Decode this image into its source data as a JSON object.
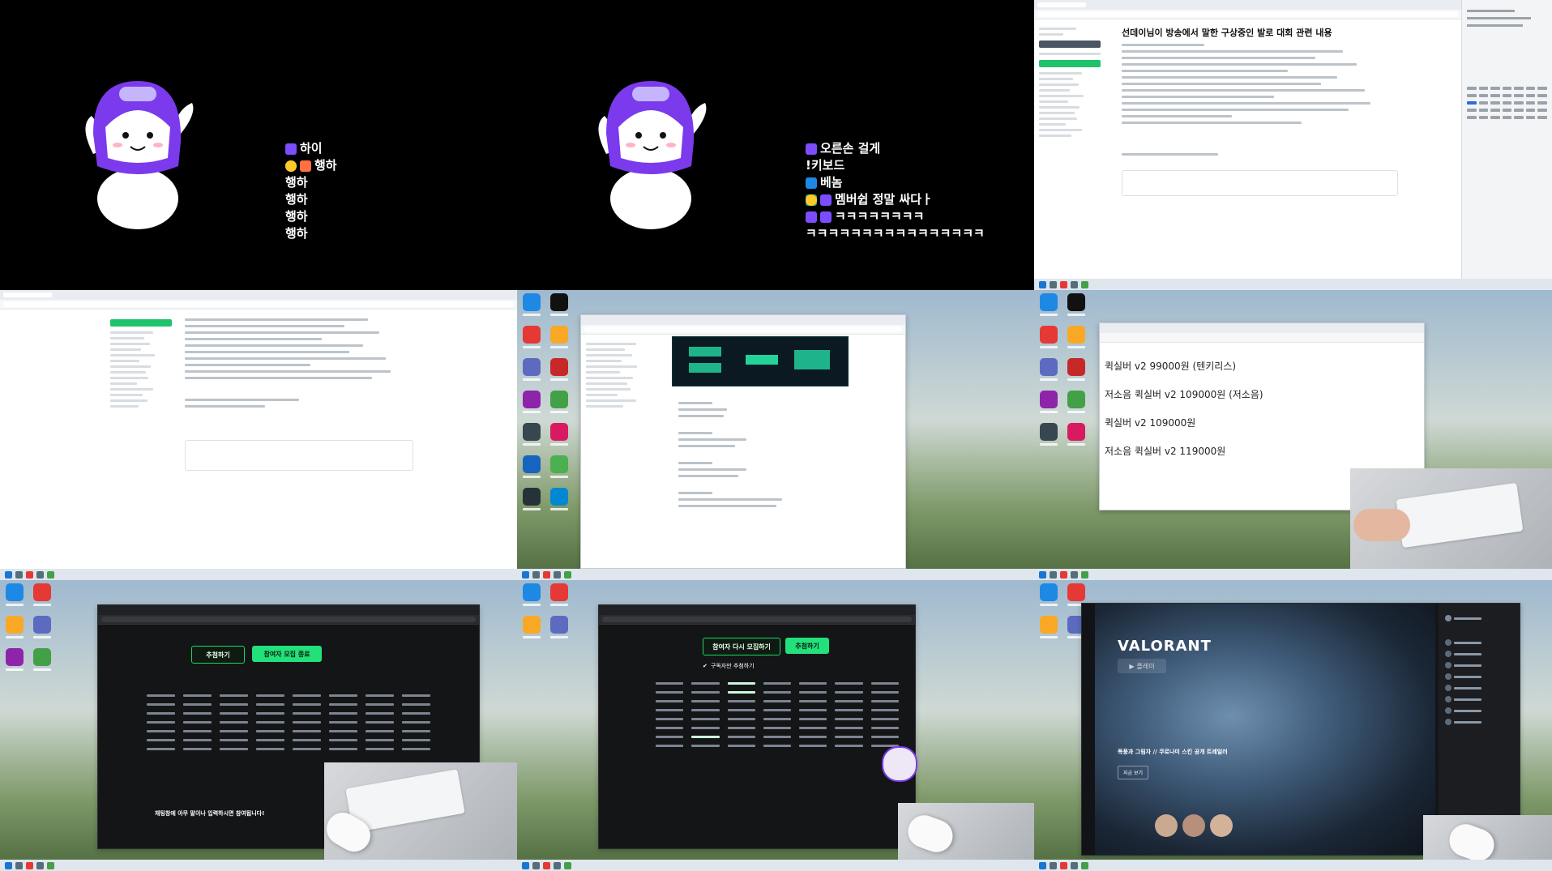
{
  "tiles": {
    "t1": {
      "chat": [
        {
          "text": "하이",
          "icons": [
            "heart"
          ]
        },
        {
          "text": "행하",
          "icons": [
            "ghost",
            "fire",
            "hand"
          ]
        },
        {
          "text": "행하",
          "icons": []
        },
        {
          "text": "행하",
          "icons": []
        },
        {
          "text": "행하",
          "icons": []
        },
        {
          "text": "행하",
          "icons": []
        }
      ]
    },
    "t2": {
      "chat": [
        {
          "text": "오른손 걸게",
          "icons": [
            "heart"
          ]
        },
        {
          "text": "!키보드",
          "icons": []
        },
        {
          "text": "베놈",
          "icons": [
            "blue"
          ]
        },
        {
          "text": "멤버쉽 정말 싸다ㅏ",
          "icons": [
            "leaf",
            "heart",
            "hand"
          ]
        },
        {
          "text": "ㅋㅋㅋㅋㅋㅋㅋㅋ",
          "icons": [
            "heart",
            "heart"
          ]
        },
        {
          "text": "ㅋㅋㅋㅋㅋㅋㅋㅋㅋㅋㅋㅋㅋㅋㅋㅋ",
          "icons": []
        }
      ]
    },
    "t3": {
      "title": "선데이님이 방송에서 말한 구상중인 발로 대회 관련 내용"
    },
    "t6": {
      "lines": [
        "퀵실버 v2 99000원 (텐키리스)",
        "저소음 퀵실버 v2 109000원 (저소음)",
        "퀵실버 v2 109000원",
        "저소음 퀵실버 v2 119000원"
      ]
    },
    "t7": {
      "buttons": {
        "a": "추첨하기",
        "b": "참여자 모집 종료"
      },
      "banner": "채팅창에 아무 말이나 입력하시면 참여됩니다!"
    },
    "t8": {
      "buttons": {
        "a": "참여자 다시 모집하기",
        "b": "추첨하기"
      },
      "toggle": "구독자만 추첨하기"
    },
    "t9": {
      "logo": "VALORANT",
      "play": "플레이",
      "headline": "폭풍과 그림자 // 쿠로나미 스킨 공개 트레일러",
      "cta": "지금 보기"
    }
  },
  "colors": {
    "accent_green": "#22e07a",
    "avatar_purple": "#7c3aed"
  }
}
